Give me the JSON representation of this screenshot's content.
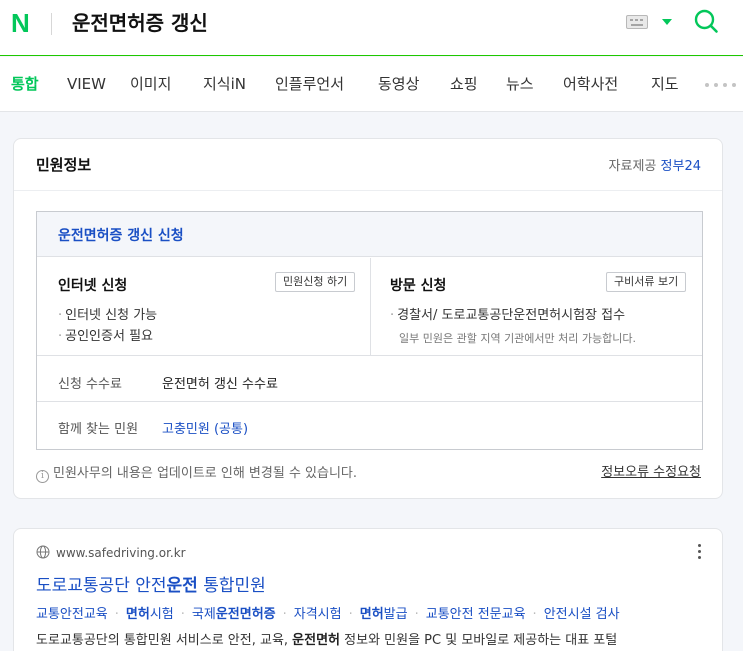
{
  "header": {
    "logo": "N",
    "query": "운전면허증 갱신",
    "keyboard_icon": "keyboard-icon",
    "dropdown_icon": "caret-down-icon",
    "search_icon": "search-icon",
    "brand_color": "#03c75a"
  },
  "tabs": [
    {
      "label": "통합",
      "active": true
    },
    {
      "label": "VIEW"
    },
    {
      "label": "이미지"
    },
    {
      "label": "지식iN"
    },
    {
      "label": "인플루언서"
    },
    {
      "label": "동영상"
    },
    {
      "label": "쇼핑"
    },
    {
      "label": "뉴스"
    },
    {
      "label": "어학사전"
    },
    {
      "label": "지도"
    }
  ],
  "civil": {
    "title": "민원정보",
    "source_prefix": "자료제공",
    "source_name": "정부24",
    "box_title": "운전면허증 갱신 신청",
    "internet": {
      "title": "인터넷 신청",
      "button": "민원신청 하기",
      "bullets": [
        "인터넷 신청 가능",
        "공인인증서 필요"
      ]
    },
    "visit": {
      "title": "방문 신청",
      "button": "구비서류 보기",
      "bullets": [
        "경찰서/ 도로교통공단운전면허시험장 접수"
      ],
      "note": "일부 민원은 관할 지역 기관에서만 처리 가능합니다."
    },
    "fee_label": "신청 수수료",
    "fee_value": "운전면허 갱신 수수료",
    "related_label": "함께 찾는 민원",
    "related_link": "고충민원 (공통)",
    "info_text": "민원사무의 내용은 업데이트로 인해 변경될 수 있습니다.",
    "report_link": "정보오류 수정요청"
  },
  "result": {
    "site": "www.safedriving.or.kr",
    "title_pre": "도로교통공단 안전",
    "title_bold": "운전",
    "title_post": " 통합민원",
    "sitelinks": [
      {
        "pre": "교통안전교육",
        "bold": "",
        "post": ""
      },
      {
        "pre": "",
        "bold": "면허",
        "post": "시험"
      },
      {
        "pre": "국제",
        "bold": "운전면허증",
        "post": ""
      },
      {
        "pre": "자격시험",
        "bold": "",
        "post": ""
      },
      {
        "pre": "",
        "bold": "면허",
        "post": "발급"
      },
      {
        "pre": "교통안전 전문교육",
        "bold": "",
        "post": ""
      },
      {
        "pre": "안전시설 검사",
        "bold": "",
        "post": ""
      }
    ],
    "snippet_pre": "도로교통공단의 통합민원 서비스로 안전, 교육, ",
    "snippet_bold": "운전면허",
    "snippet_post": " 정보와 민원을 PC 및 모바일로 제공하는 대표 포털"
  }
}
